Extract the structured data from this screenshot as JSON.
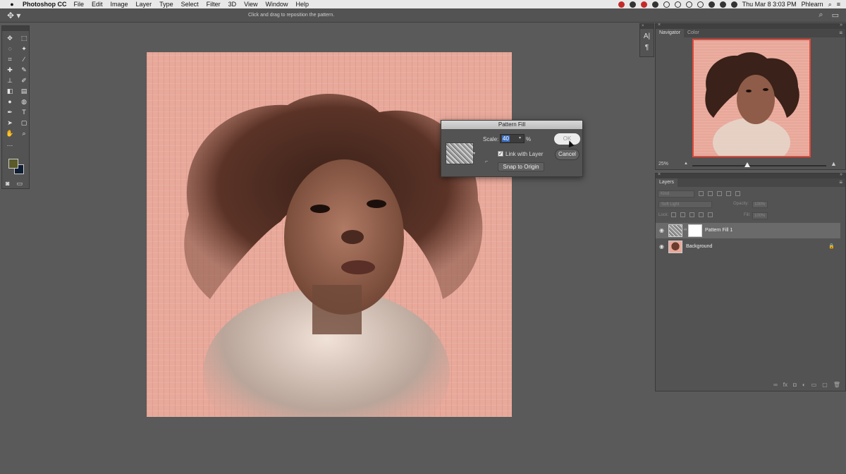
{
  "menubar": {
    "app_name": "Photoshop CC",
    "items": [
      "File",
      "Edit",
      "Image",
      "Layer",
      "Type",
      "Select",
      "Filter",
      "3D",
      "View",
      "Window",
      "Help"
    ],
    "clock": "Thu Mar 8  3:03 PM",
    "user": "Phlearn"
  },
  "options_bar": {
    "hint": "Click and drag to reposition the pattern."
  },
  "dialog": {
    "title": "Pattern Fill",
    "scale_label": "Scale:",
    "scale_value": "40",
    "percent": "%",
    "link_with_layer": "Link with Layer",
    "link_checked": true,
    "snap_to_origin": "Snap to Origin",
    "ok": "OK",
    "cancel": "Cancel"
  },
  "char_panel": {
    "glyph1": "A|",
    "glyph2": "¶"
  },
  "navigator": {
    "tabs": [
      "Navigator",
      "Color"
    ],
    "zoom": "25%"
  },
  "layers": {
    "title": "Layers",
    "kind_placeholder": "Kind",
    "blend_mode": "Soft Light",
    "opacity_label": "Opacity:",
    "opacity": "100%",
    "lock_label": "Lock:",
    "fill_label": "Fill:",
    "fill": "100%",
    "items": [
      {
        "name": "Pattern Fill 1",
        "selected": true
      },
      {
        "name": "Background",
        "selected": false
      }
    ]
  },
  "colors": {
    "foreground": "#5a5a2a",
    "background": "#0f1e33",
    "accent": "#e24a3a"
  }
}
